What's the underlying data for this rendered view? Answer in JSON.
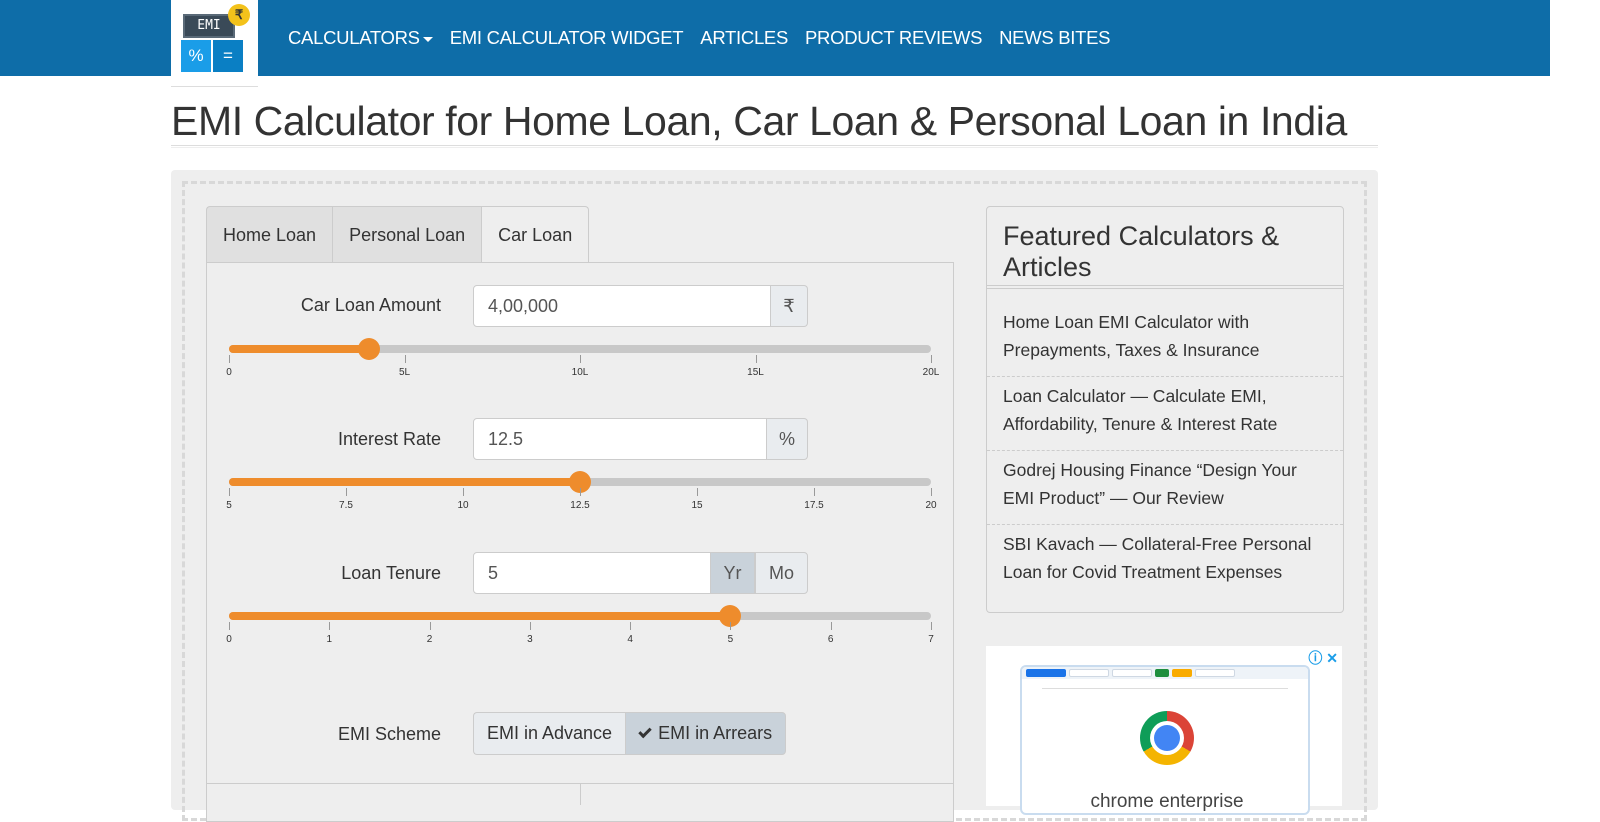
{
  "logo": {
    "screen_text": "EMI",
    "badge": "₹",
    "key_left": "%",
    "key_right": "="
  },
  "nav": {
    "items": [
      {
        "label": "CALCULATORS"
      },
      {
        "label": "EMI CALCULATOR WIDGET"
      },
      {
        "label": "ARTICLES"
      },
      {
        "label": "PRODUCT REVIEWS"
      },
      {
        "label": "NEWS BITES"
      }
    ]
  },
  "page_title": "EMI Calculator for Home Loan, Car Loan & Personal Loan in India",
  "tabs": [
    {
      "label": "Home Loan",
      "active": false
    },
    {
      "label": "Personal Loan",
      "active": false
    },
    {
      "label": "Car Loan",
      "active": true
    }
  ],
  "form": {
    "amount": {
      "label": "Car Loan Amount",
      "value": "4,00,000",
      "unit": "₹",
      "slider": {
        "min": 0,
        "max": 20,
        "value": 4,
        "ticks": [
          "0",
          "5L",
          "10L",
          "15L",
          "20L"
        ]
      }
    },
    "rate": {
      "label": "Interest Rate",
      "value": "12.5",
      "unit": "%",
      "slider": {
        "min": 5,
        "max": 20,
        "value": 12.5,
        "ticks": [
          "5",
          "7.5",
          "10",
          "12.5",
          "15",
          "17.5",
          "20"
        ]
      }
    },
    "tenure": {
      "label": "Loan Tenure",
      "value": "5",
      "unit_year": "Yr",
      "unit_month": "Mo",
      "selected_unit": "Yr",
      "slider": {
        "min": 0,
        "max": 7,
        "value": 5,
        "ticks": [
          "0",
          "1",
          "2",
          "3",
          "4",
          "5",
          "6",
          "7"
        ]
      }
    },
    "scheme": {
      "label": "EMI Scheme",
      "options": [
        "EMI in Advance",
        "EMI in Arrears"
      ],
      "selected": "EMI in Arrears"
    }
  },
  "sidebar": {
    "heading": "Featured Calculators & Articles",
    "items": [
      {
        "label": "Home Loan EMI Calculator with Prepayments, Taxes & Insurance"
      },
      {
        "label": "Loan Calculator — Calculate EMI, Affordability, Tenure & Interest Rate"
      },
      {
        "label": "Godrej Housing Finance “Design Your EMI Product” — Our Review"
      },
      {
        "label": "SBI Kavach — Collateral-Free Personal Loan for Covid Treatment Expenses"
      }
    ]
  },
  "ad": {
    "text": "chrome enterprise"
  },
  "colors": {
    "nav": "#0e6da8",
    "accent": "#ee8c2c",
    "panel": "#eeeeee"
  }
}
